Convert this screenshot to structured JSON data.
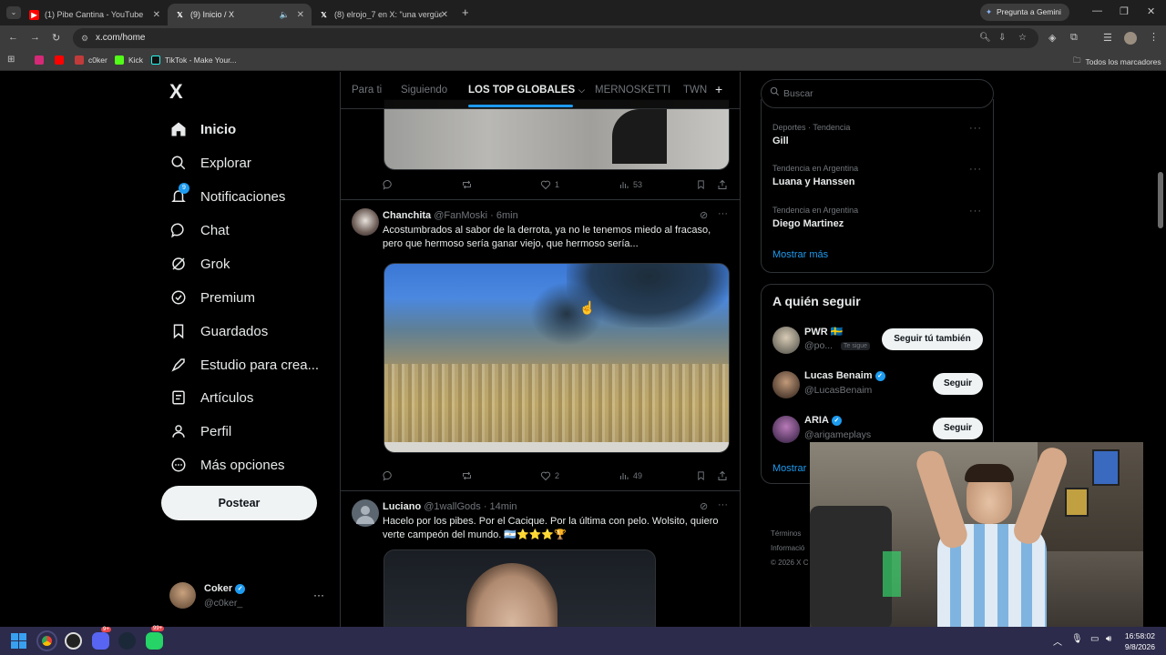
{
  "browser": {
    "tabs": [
      {
        "title": "(1) Pibe Cantina - YouTube",
        "active": false
      },
      {
        "title": "(9) Inicio / X",
        "active": true
      },
      {
        "title": "(8) elrojo_7 en X: \"una vergüenz",
        "active": false
      }
    ],
    "new_tab": "+",
    "gemini_button": "Pregunta a Gemini",
    "url": "x.com/home",
    "bookmarks": [
      "c0ker",
      "Kick",
      "TikTok - Make Your..."
    ],
    "all_bookmarks": "Todos los marcadores"
  },
  "sidebar": {
    "logo": "X",
    "items": [
      {
        "label": "Inicio",
        "icon": "home-icon"
      },
      {
        "label": "Explorar",
        "icon": "search-icon"
      },
      {
        "label": "Notificaciones",
        "icon": "bell-icon",
        "badge": "9"
      },
      {
        "label": "Chat",
        "icon": "chat-icon"
      },
      {
        "label": "Grok",
        "icon": "grok-icon"
      },
      {
        "label": "Premium",
        "icon": "premium-icon"
      },
      {
        "label": "Guardados",
        "icon": "bookmark-icon"
      },
      {
        "label": "Estudio para crea...",
        "icon": "rocket-icon"
      },
      {
        "label": "Artículos",
        "icon": "article-icon"
      },
      {
        "label": "Perfil",
        "icon": "person-icon"
      },
      {
        "label": "Más opciones",
        "icon": "more-icon"
      }
    ],
    "post_button": "Postear",
    "account": {
      "name": "Coker",
      "handle": "@c0ker_",
      "more": "···"
    }
  },
  "feed": {
    "tabs": [
      "Para ti",
      "Siguiendo",
      "LOS TOP GLOBALES",
      "MERNOSKETTI",
      "TWN"
    ],
    "add_tab": "+",
    "top_actions": {
      "likes": "1",
      "views": "53"
    },
    "tweets": [
      {
        "name": "Chanchita",
        "handle": "@FanMoski",
        "time": "· 6min",
        "text": "Acostumbrados al sabor de la derrota, ya no le tenemos miedo al fracaso, pero que hermoso sería ganar viejo, que hermoso sería...",
        "likes": "2",
        "views": "49"
      },
      {
        "name": "Luciano",
        "handle": "@1wallGods",
        "time": "· 14min",
        "text": "Hacelo por los pibes. Por el Cacique. Por la última con pelo. Wolsito, quiero verte campeón del mundo. 🇦🇷⭐⭐⭐🏆"
      }
    ]
  },
  "right": {
    "search_placeholder": "Buscar",
    "trends": [
      {
        "category": "Deportes · Tendencia",
        "name": "Gill"
      },
      {
        "category": "Tendencia en Argentina",
        "name": "Luana y Hanssen"
      },
      {
        "category": "Tendencia en Argentina",
        "name": "Diego Martinez"
      }
    ],
    "show_more": "Mostrar más",
    "who_to_follow_title": "A quién seguir",
    "who_to_follow": [
      {
        "name": "PWR 🇸🇪",
        "handle": "@po...",
        "badge": "Te sigue",
        "button": "Seguir tú también"
      },
      {
        "name": "Lucas Benaim",
        "handle": "@LucasBenaim",
        "button": "Seguir"
      },
      {
        "name": "ARIA",
        "handle": "@arigameplays",
        "button": "Seguir"
      }
    ],
    "show_more_2": "Mostrar",
    "footer": [
      "Términos",
      "Informació",
      "© 2026 X C"
    ]
  },
  "taskbar": {
    "badges": [
      "9+",
      "99+"
    ],
    "time": "16:58:02",
    "date": "9/8/2026"
  },
  "colors": {
    "accent": "#1d9bf0",
    "bg": "#000000",
    "border": "#2f3336",
    "muted": "#71767b"
  }
}
